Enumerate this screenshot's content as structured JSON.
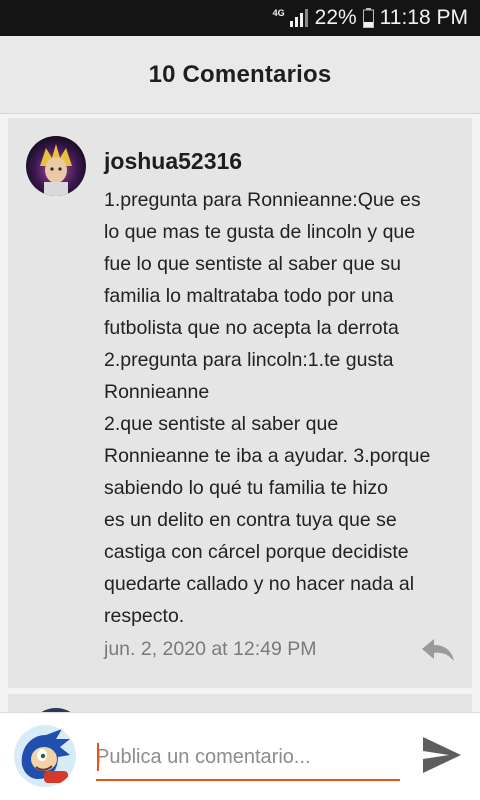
{
  "status_bar": {
    "network": "4G",
    "battery_percent": "22%",
    "time": "11:18 PM",
    "icons": [
      "signal-icon",
      "battery-icon"
    ]
  },
  "header": {
    "title": "10 Comentarios"
  },
  "comment": {
    "username": "joshua52316",
    "text": "1.pregunta para Ronnieanne:Que es\nlo que mas te gusta de lincoln y que\nfue lo que sentiste al saber que su\nfamilia lo maltrataba todo por una\nfutbolista que no acepta la derrota\n2.pregunta para lincoln:1.te gusta\nRonnieanne\n2.que sentiste al saber que\nRonnieanne te iba a ayudar. 3.porque\nsabiendo lo qué tu familia te hizo\nes un delito en contra tuya que se\ncastiga con cárcel porque decidiste\nquedarte callado y no hacer nada al\nrespecto.",
    "timestamp": "jun. 2, 2020 at 12:49 PM",
    "reply_icon": "reply-icon"
  },
  "composer": {
    "placeholder": "Publica un comentario...",
    "send_icon": "send-icon"
  },
  "colors": {
    "status_bar_bg": "#141414",
    "header_bg": "#e9e9e9",
    "card_bg": "#e5e5e5",
    "accent": "#e5541a"
  }
}
